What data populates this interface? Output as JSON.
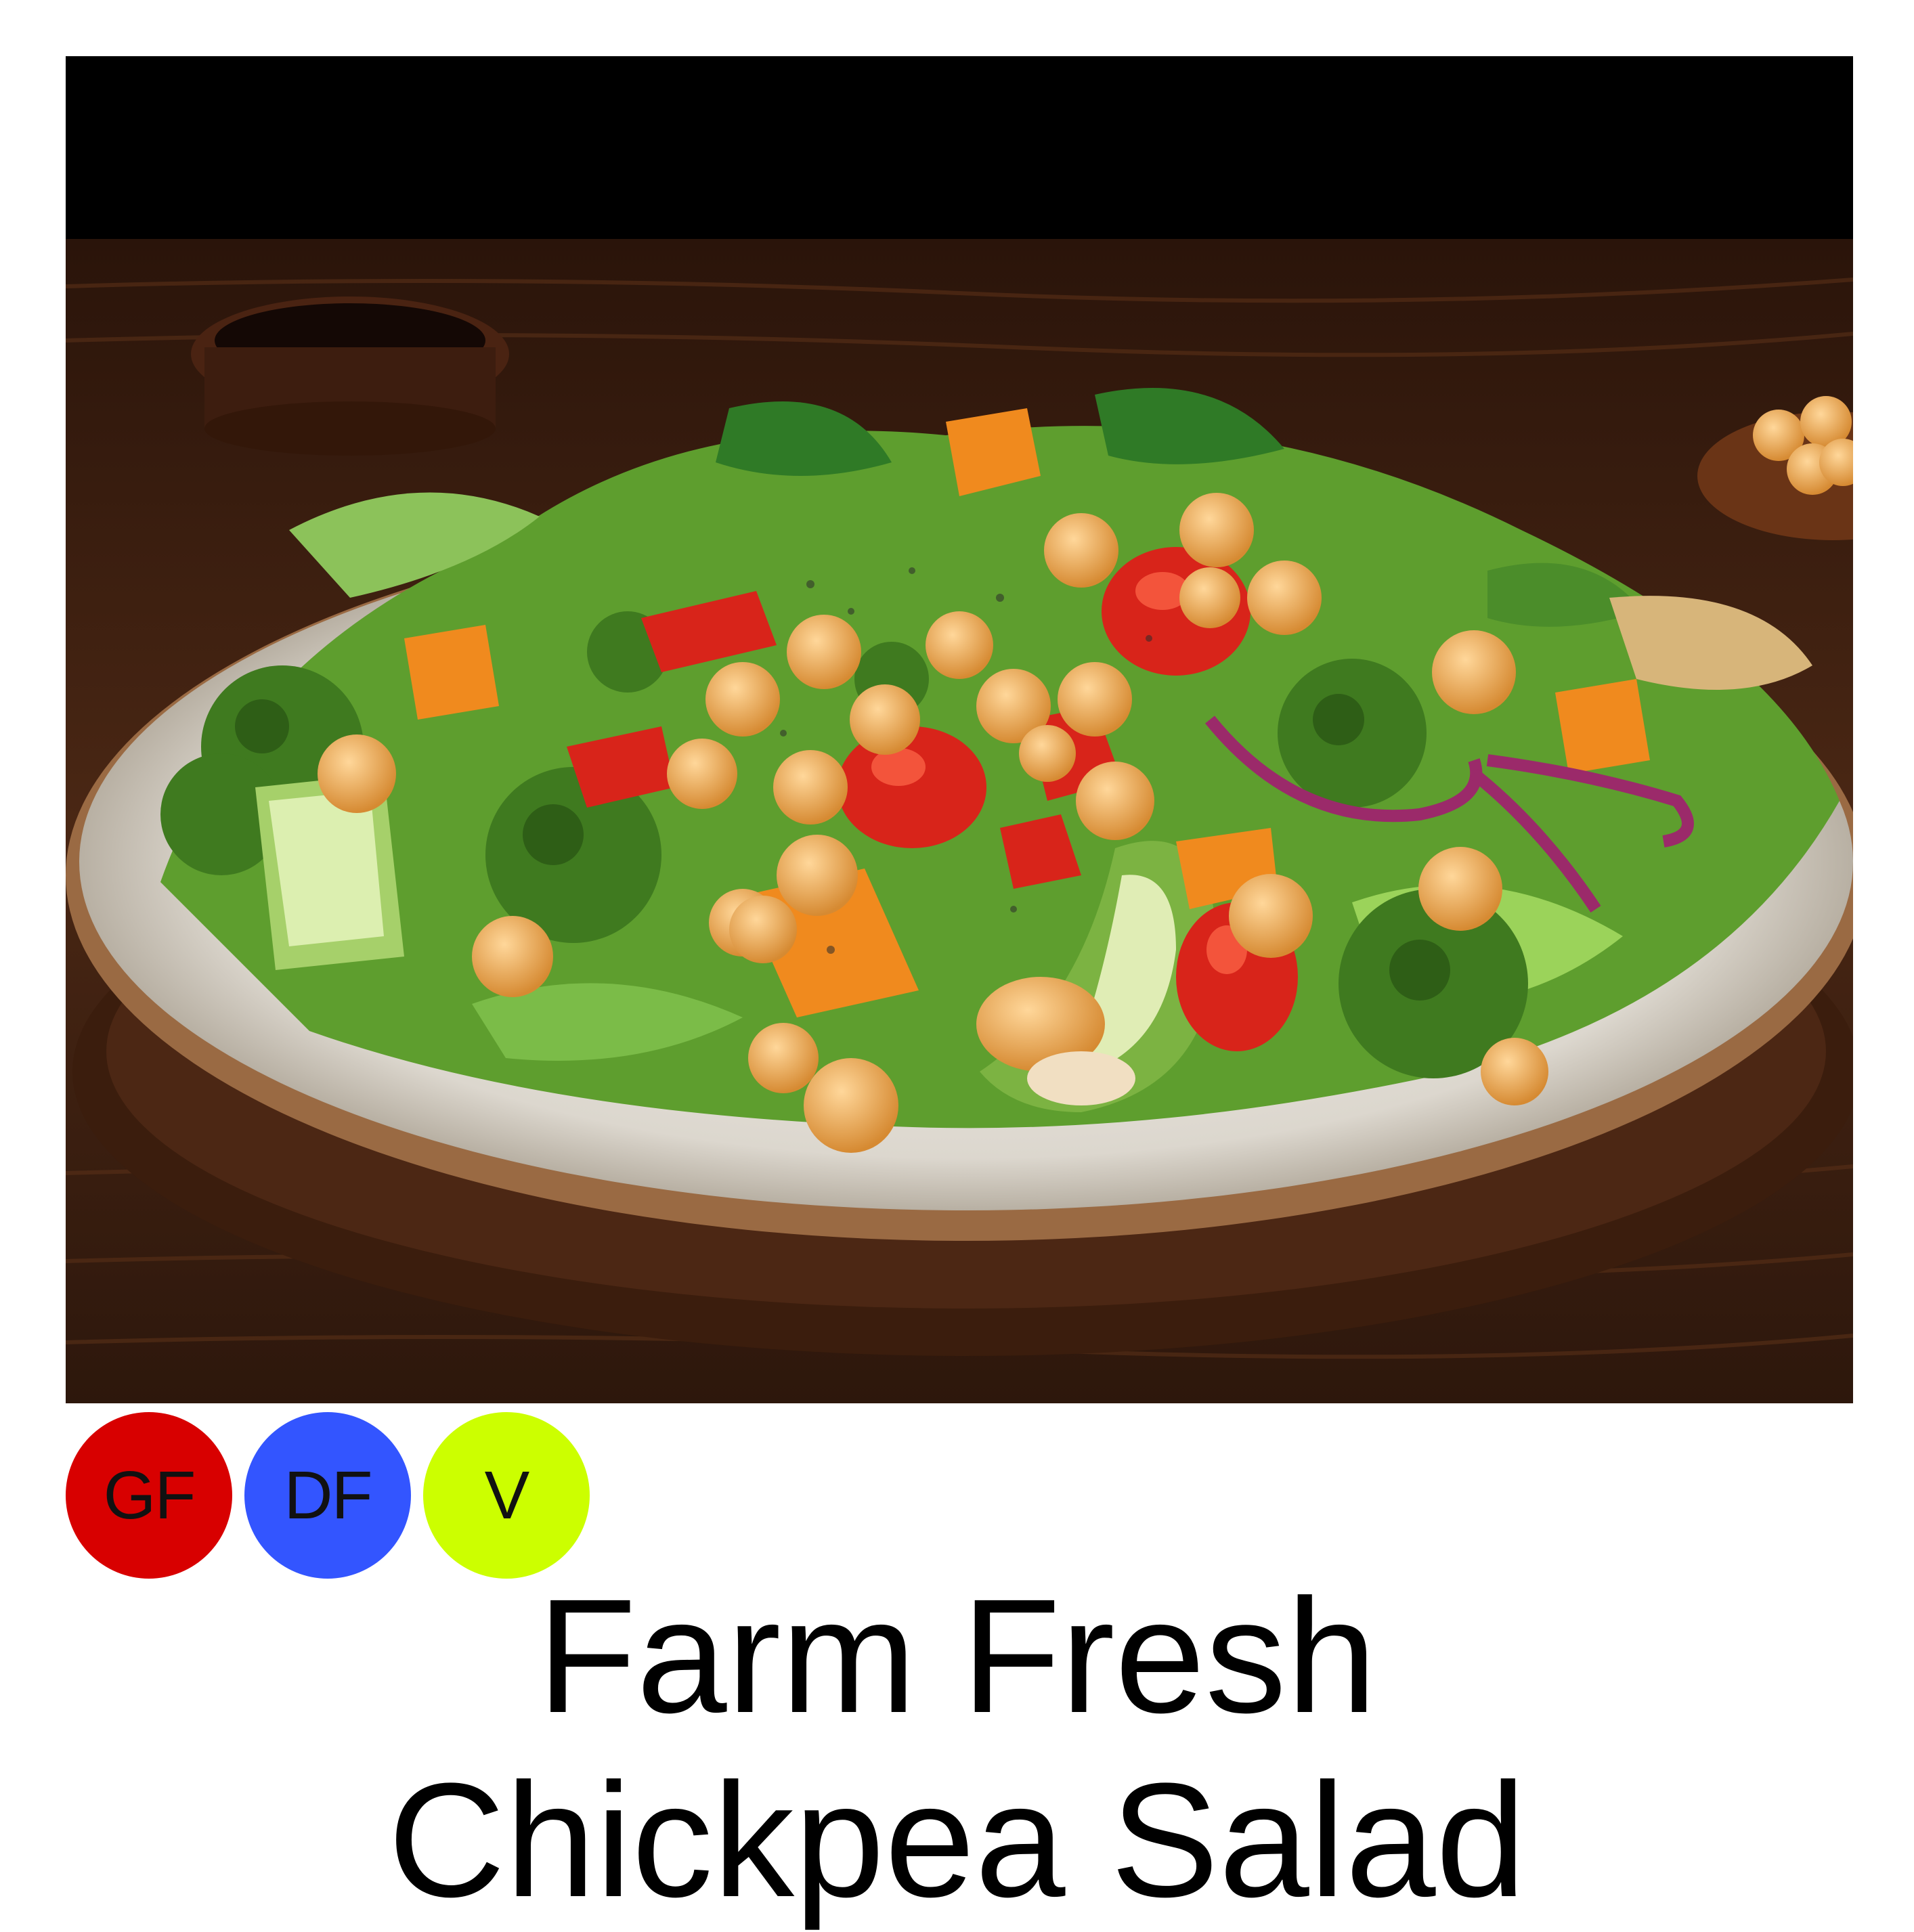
{
  "image": {
    "icon": "salad-photo",
    "colors": {
      "background_top": "#000000",
      "table": "#3a1f12",
      "plate": "#e7e3dc",
      "plate_rim": "#8a5a34",
      "chickpea": "#e8a84f",
      "tomato": "#d8241a",
      "broccoli": "#3f7a1f",
      "lettuce": "#6fb03a"
    }
  },
  "badges": [
    {
      "label": "GF",
      "color": "#d80000"
    },
    {
      "label": "DF",
      "color": "#3355ff"
    },
    {
      "label": "V",
      "color": "#ccff00"
    }
  ],
  "title": {
    "line1": "Farm Fresh",
    "line2": "Chickpea Salad"
  }
}
